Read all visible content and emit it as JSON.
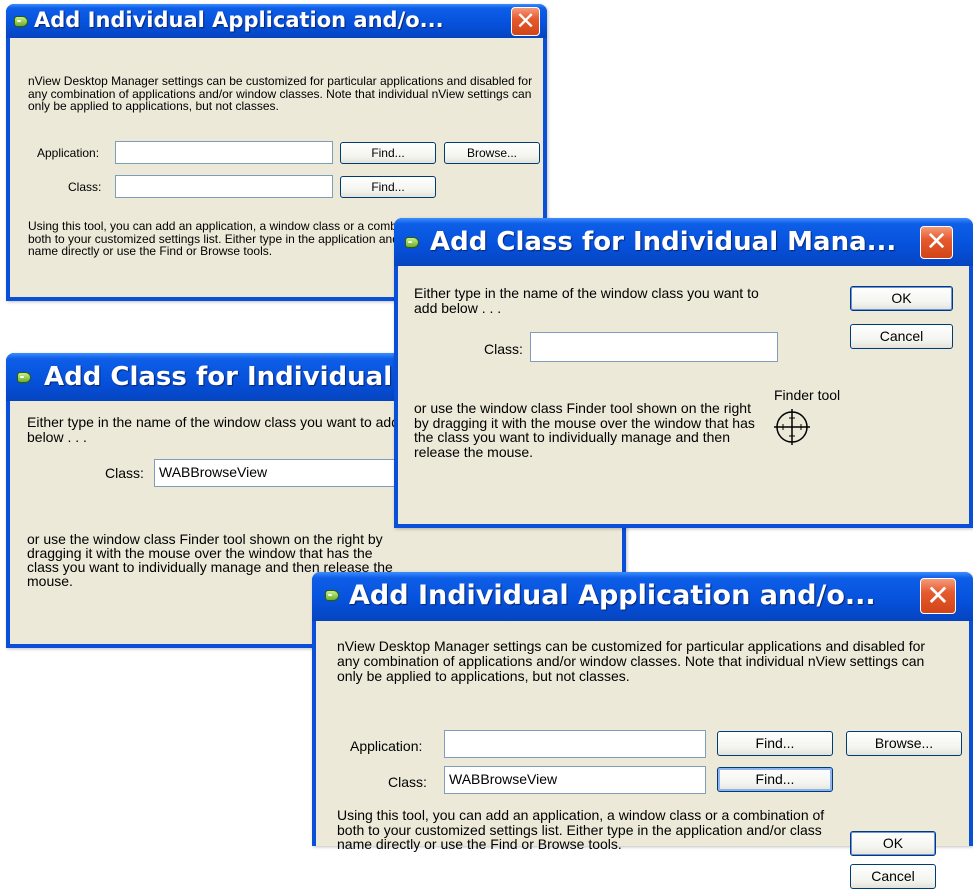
{
  "dialog_add_app": {
    "title": "Add Individual Application and/o...",
    "close_label": "✕",
    "intro": "nView Desktop Manager settings can be customized for particular applications and disabled for any combination of applications and/or window classes. Note that individual nView settings can only be applied to applications, but not classes.",
    "application_label": "Application:",
    "application_value": "",
    "class_label": "Class:",
    "class_value": "",
    "find_label": "Find...",
    "find_class_label": "Find...",
    "browse_label": "Browse...",
    "help": "Using this tool, you can add an application, a window class or a combination of both to your customized settings list. Either type in the application and/or class name directly or use the Find or Browse tools."
  },
  "dialog_add_class_back": {
    "title": "Add Class for Individual Mana...",
    "intro": "Either type in the name of the window class you want to add below . . .",
    "class_label": "Class:",
    "class_value": "WABBrowseView",
    "help": "or use the window class Finder tool shown on the right by dragging it with the mouse over the window that has the class you want to individually manage and then release the mouse."
  },
  "dialog_add_class": {
    "title": "Add Class for Individual Mana...",
    "close_label": "✕",
    "intro": "Either type in the name of the window class you want to add below . . .",
    "class_label": "Class:",
    "class_value": "",
    "ok_label": "OK",
    "cancel_label": "Cancel",
    "finder_label": "Finder tool",
    "help": "or use the window class Finder tool shown on the right by dragging it with the mouse over the window that has the class you want to individually manage and then release the mouse."
  },
  "dialog_add_app_filled": {
    "title": "Add Individual Application and/o...",
    "close_label": "✕",
    "intro": "nView Desktop Manager settings can be customized for particular applications and disabled for any combination of applications and/or window classes. Note that individual nView settings can only be applied to applications, but not classes.",
    "application_label": "Application:",
    "application_value": "",
    "class_label": "Class:",
    "class_value": "WABBrowseView",
    "find_label": "Find...",
    "find_class_label": "Find...",
    "browse_label": "Browse...",
    "ok_label": "OK",
    "cancel_label": "Cancel",
    "help": "Using this tool, you can add an application, a window class or a combination of both to your customized settings list. Either type in the application and/or class name directly or use the Find or Browse tools."
  },
  "colors": {
    "titlebar": "#0652dd",
    "client": "#ece9d8",
    "close": "#e55a2e",
    "field_border": "#7f9db9"
  }
}
